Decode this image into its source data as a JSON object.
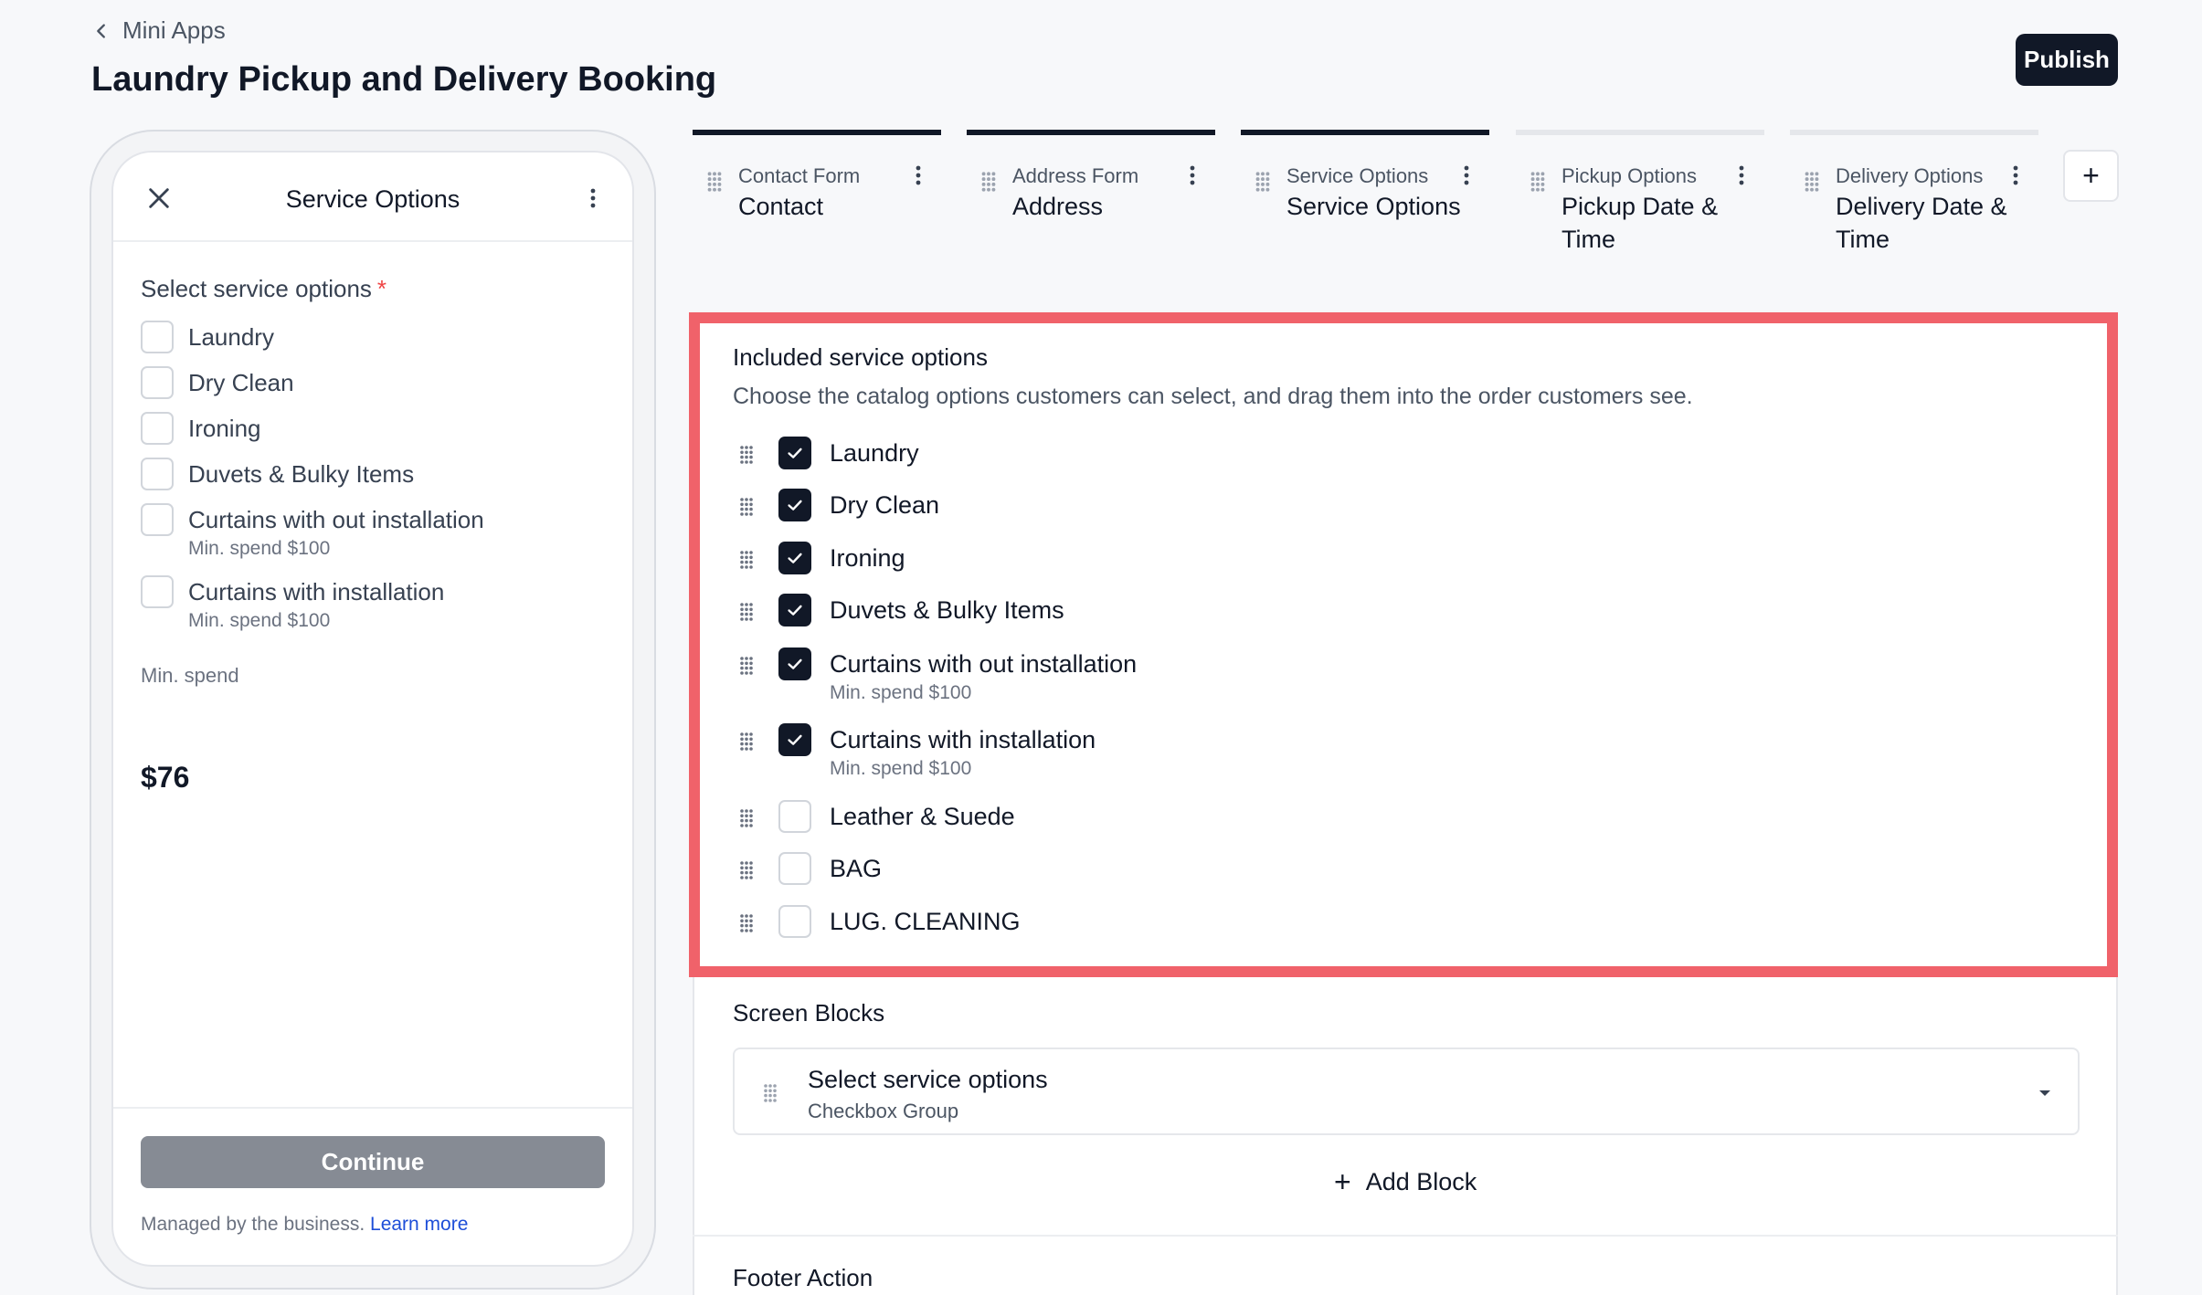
{
  "header": {
    "back_label": "Mini Apps",
    "title": "Laundry Pickup and Delivery Booking",
    "publish_label": "Publish"
  },
  "preview": {
    "title": "Service Options",
    "group_label": "Select service options",
    "required_mark": "*",
    "options": [
      {
        "label": "Laundry",
        "sub": ""
      },
      {
        "label": "Dry Clean",
        "sub": ""
      },
      {
        "label": "Ironing",
        "sub": ""
      },
      {
        "label": "Duvets & Bulky Items",
        "sub": ""
      },
      {
        "label": "Curtains with out installation",
        "sub": "Min. spend $100"
      },
      {
        "label": "Curtains with installation",
        "sub": "Min. spend $100"
      }
    ],
    "min_spend_label": "Min. spend",
    "total": "$76",
    "continue_label": "Continue",
    "managed_text": "Managed by the business.",
    "learn_more": "Learn more"
  },
  "steps": [
    {
      "sub": "Contact Form",
      "main": "Contact",
      "active": true
    },
    {
      "sub": "Address Form",
      "main": "Address",
      "active": true
    },
    {
      "sub": "Service Options",
      "main": "Service Options",
      "active": true
    },
    {
      "sub": "Pickup Options",
      "main": "Pickup Date & Time",
      "active": false
    },
    {
      "sub": "Delivery Options",
      "main": "Delivery Date & Time",
      "active": false
    }
  ],
  "add_step_label": "+",
  "included": {
    "title": "Included service options",
    "description": "Choose the catalog options customers can select, and drag them into the order customers see.",
    "options": [
      {
        "label": "Laundry",
        "sub": "",
        "checked": true
      },
      {
        "label": "Dry Clean",
        "sub": "",
        "checked": true
      },
      {
        "label": "Ironing",
        "sub": "",
        "checked": true
      },
      {
        "label": "Duvets & Bulky Items",
        "sub": "",
        "checked": true
      },
      {
        "label": "Curtains with out installation",
        "sub": "Min. spend $100",
        "checked": true
      },
      {
        "label": "Curtains with installation",
        "sub": "Min. spend $100",
        "checked": true
      },
      {
        "label": "Leather & Suede",
        "sub": "",
        "checked": false
      },
      {
        "label": "BAG",
        "sub": "",
        "checked": false
      },
      {
        "label": "LUG. CLEANING",
        "sub": "",
        "checked": false
      }
    ]
  },
  "screen_blocks": {
    "title": "Screen Blocks",
    "block_title": "Select service options",
    "block_type": "Checkbox Group",
    "add_label": "Add Block"
  },
  "footer_action": {
    "title": "Footer Action"
  },
  "colors": {
    "highlight": "#f0626a",
    "dark": "#111827",
    "link": "#1d4ed8",
    "continue_bg": "#868b94"
  }
}
